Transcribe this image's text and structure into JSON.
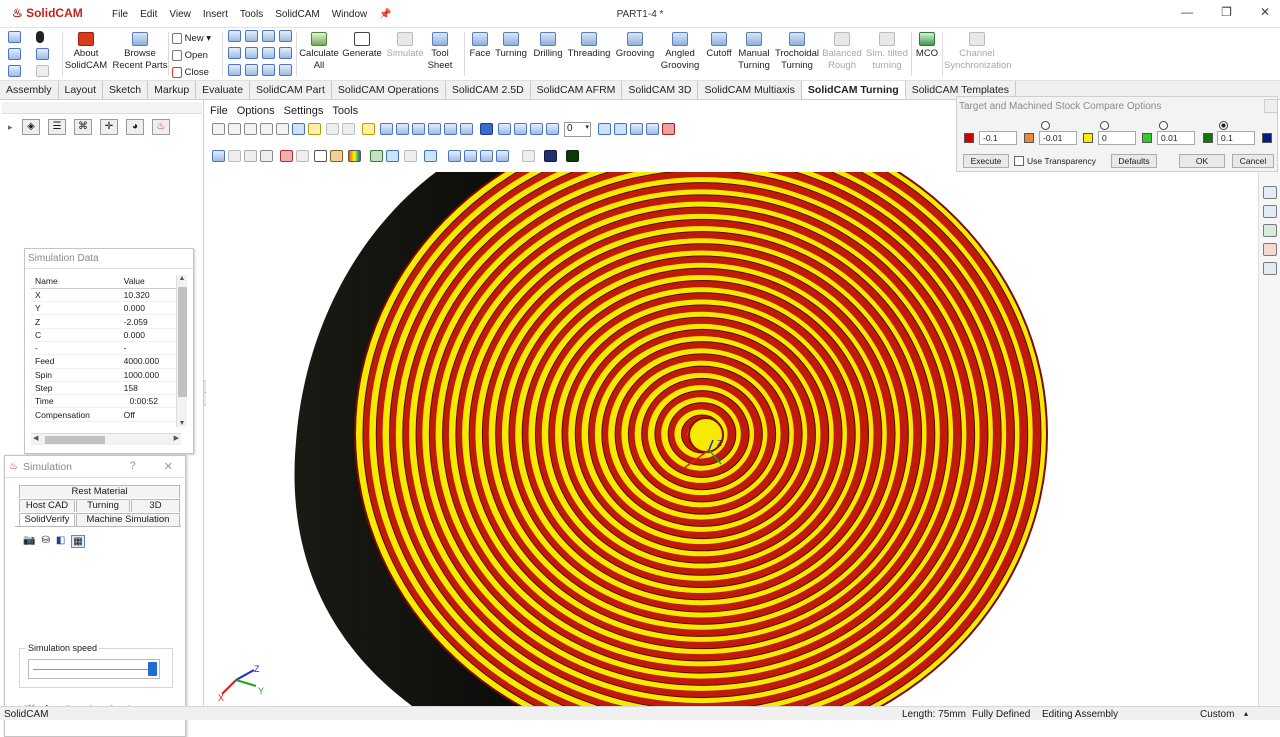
{
  "app": {
    "name": "SolidCAM",
    "menu": [
      "File",
      "Edit",
      "View",
      "Insert",
      "Tools",
      "SolidCAM",
      "Window"
    ],
    "document_title": "PART1-4 *"
  },
  "ribbon": {
    "file_group": {
      "new": "New",
      "open": "Open",
      "close": "Close"
    },
    "buttons": [
      {
        "label": "About\nSolidCAM",
        "enabled": true,
        "icon": "solidcam-logo-icon"
      },
      {
        "label": "Browse\nRecent Parts",
        "enabled": true,
        "icon": "browse-icon"
      },
      {
        "label": "Calculate\nAll",
        "enabled": true,
        "icon": "calculator-icon"
      },
      {
        "label": "Generate",
        "enabled": true,
        "icon": "gcode-icon"
      },
      {
        "label": "Simulate",
        "enabled": false,
        "icon": "simulate-icon"
      },
      {
        "label": "Tool\nSheet",
        "enabled": true,
        "icon": "tool-sheet-icon"
      },
      {
        "label": "Face",
        "enabled": true,
        "icon": "face-icon"
      },
      {
        "label": "Turning",
        "enabled": true,
        "icon": "turning-icon"
      },
      {
        "label": "Drilling",
        "enabled": true,
        "icon": "drilling-icon"
      },
      {
        "label": "Threading",
        "enabled": true,
        "icon": "threading-icon"
      },
      {
        "label": "Grooving",
        "enabled": true,
        "icon": "grooving-icon"
      },
      {
        "label": "Angled\nGrooving",
        "enabled": true,
        "icon": "angled-grooving-icon"
      },
      {
        "label": "Cutoff",
        "enabled": true,
        "icon": "cutoff-icon"
      },
      {
        "label": "Manual\nTurning",
        "enabled": true,
        "icon": "manual-turning-icon"
      },
      {
        "label": "Trochoidal\nTurning",
        "enabled": true,
        "icon": "trochoidal-icon"
      },
      {
        "label": "Balanced\nRough",
        "enabled": false,
        "icon": "balanced-rough-icon"
      },
      {
        "label": "Sim. tilted\nturning",
        "enabled": false,
        "icon": "tilted-turning-icon"
      },
      {
        "label": "MCO",
        "enabled": true,
        "icon": "mco-icon"
      },
      {
        "label": "Channel\nSynchronization",
        "enabled": false,
        "icon": "channel-sync-icon"
      }
    ]
  },
  "tabs": [
    "Assembly",
    "Layout",
    "Sketch",
    "Markup",
    "Evaluate",
    "SolidCAM Part",
    "SolidCAM Operations",
    "SolidCAM 2.5D",
    "SolidCAM AFRM",
    "SolidCAM 3D",
    "SolidCAM Multiaxis",
    "SolidCAM Turning",
    "SolidCAM Templates"
  ],
  "active_tab": "SolidCAM Turning",
  "sim_menu": [
    "File",
    "Options",
    "Settings",
    "Tools"
  ],
  "zoom_select": "0",
  "simulation_data": {
    "title": "Simulation Data",
    "headers": [
      "Name",
      "Value"
    ],
    "rows": [
      [
        "X",
        "10.320"
      ],
      [
        "Y",
        "0.000"
      ],
      [
        "Z",
        "-2.059"
      ],
      [
        "C",
        "0.000"
      ],
      [
        "-",
        "-"
      ],
      [
        "Feed",
        "4000.000"
      ],
      [
        "Spin",
        "1000.000"
      ],
      [
        "Step",
        "158"
      ],
      [
        "Time",
        "0:00:52"
      ],
      [
        "Compensation",
        "Off"
      ]
    ]
  },
  "simulation": {
    "title": "Simulation",
    "help": "?",
    "close": "✕",
    "tabs_row1": [
      "Rest Material"
    ],
    "tabs_row2": [
      "Host CAD",
      "Turning",
      "3D"
    ],
    "tabs_row3": [
      "SolidVerify",
      "Machine Simulation"
    ],
    "speed_label": "Simulation speed",
    "speed_level": 0.97,
    "controls": [
      "⏮",
      "▶",
      "⏸",
      "⏭",
      "⏭",
      "⏏"
    ]
  },
  "compare": {
    "title": "Target and Machined Stock Compare Options",
    "values": [
      "-0.1",
      "-0.01",
      "0",
      "0.01",
      "0.1"
    ],
    "colors": [
      "#d40000",
      "#e88a3c",
      "#f5f000",
      "#2ecc2e",
      "#0a7a0a",
      "#0a1a7a"
    ],
    "selected_radio": 3,
    "execute": "Execute",
    "transparency": "Use Transparency",
    "defaults": "Defaults",
    "ok": "OK",
    "cancel": "Cancel"
  },
  "model": {
    "ring_colors": [
      "#f5ea00",
      "#c01a0a"
    ],
    "rings": 26
  },
  "status": {
    "left": "SolidCAM",
    "length": "Length: 75mm",
    "defined": "Fully Defined",
    "mode": "Editing Assembly",
    "units": "Custom"
  }
}
